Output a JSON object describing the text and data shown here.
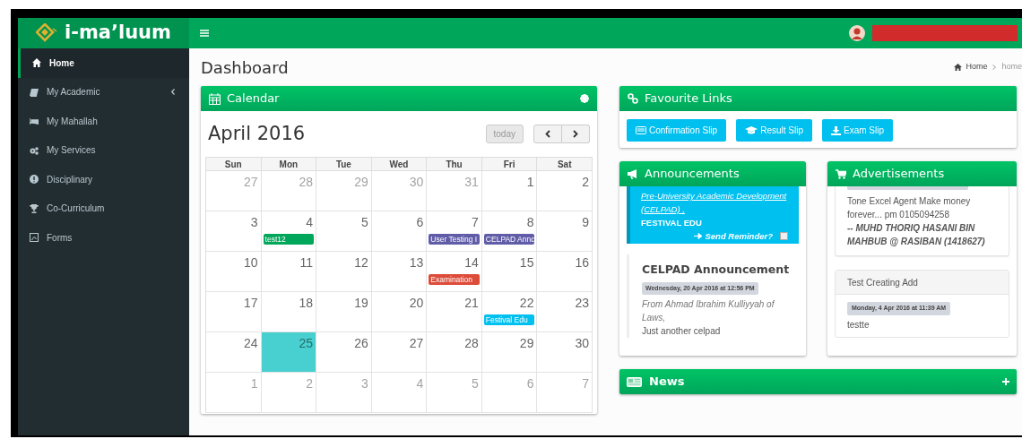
{
  "brand": {
    "logo_text": "i-maʼluum"
  },
  "sidebar": {
    "items": [
      {
        "label": "Home",
        "kind": "home",
        "selected": true,
        "expandable": false
      },
      {
        "label": "My Academic",
        "kind": "book",
        "selected": false,
        "expandable": true
      },
      {
        "label": "My Mahallah",
        "kind": "bed",
        "selected": false,
        "expandable": false
      },
      {
        "label": "My Services",
        "kind": "gears",
        "selected": false,
        "expandable": false
      },
      {
        "label": "Disciplinary",
        "kind": "alert",
        "selected": false,
        "expandable": false
      },
      {
        "label": "Co-Curriculum",
        "kind": "trophy",
        "selected": false,
        "expandable": false
      },
      {
        "label": "Forms",
        "kind": "file",
        "selected": false,
        "expandable": false
      }
    ]
  },
  "page_title": "Dashboard",
  "breadcrumb": [
    "Home",
    "home"
  ],
  "calendar": {
    "title": "Calendar",
    "month": "April 2016",
    "today_button": "today",
    "today_button_disabled": true,
    "weekdays": [
      "Sun",
      "Mon",
      "Tue",
      "Wed",
      "Thu",
      "Fri",
      "Sat"
    ],
    "weeks": [
      [
        {
          "day": "27",
          "other_month": true
        },
        {
          "day": "28",
          "other_month": true
        },
        {
          "day": "29",
          "other_month": true
        },
        {
          "day": "30",
          "other_month": true
        },
        {
          "day": "31",
          "other_month": true
        },
        {
          "day": "1",
          "other_month": false
        },
        {
          "day": "2",
          "other_month": false
        }
      ],
      [
        {
          "day": "3",
          "other_month": false
        },
        {
          "day": "4",
          "other_month": false,
          "events": [
            {
              "label": "test12",
              "color": "#00a65a"
            }
          ]
        },
        {
          "day": "5",
          "other_month": false
        },
        {
          "day": "6",
          "other_month": false
        },
        {
          "day": "7",
          "other_month": false,
          "events": [
            {
              "label": "User Testing I",
              "color": "#605ca8"
            }
          ]
        },
        {
          "day": "8",
          "other_month": false,
          "events": [
            {
              "label": "CELPAD Annc",
              "color": "#605ca8"
            }
          ]
        },
        {
          "day": "9",
          "other_month": false
        }
      ],
      [
        {
          "day": "10",
          "other_month": false
        },
        {
          "day": "11",
          "other_month": false
        },
        {
          "day": "12",
          "other_month": false
        },
        {
          "day": "13",
          "other_month": false
        },
        {
          "day": "14",
          "other_month": false,
          "events": [
            {
              "label": "Examination",
              "color": "#dd4b39"
            }
          ]
        },
        {
          "day": "15",
          "other_month": false
        },
        {
          "day": "16",
          "other_month": false
        }
      ],
      [
        {
          "day": "17",
          "other_month": false
        },
        {
          "day": "18",
          "other_month": false
        },
        {
          "day": "19",
          "other_month": false
        },
        {
          "day": "20",
          "other_month": false
        },
        {
          "day": "21",
          "other_month": false
        },
        {
          "day": "22",
          "other_month": false,
          "events": [
            {
              "label": "Festival Edu",
              "color": "#00c0ef"
            }
          ]
        },
        {
          "day": "23",
          "other_month": false
        }
      ],
      [
        {
          "day": "24",
          "other_month": false
        },
        {
          "day": "25",
          "other_month": false,
          "today": true
        },
        {
          "day": "26",
          "other_month": false
        },
        {
          "day": "27",
          "other_month": false
        },
        {
          "day": "28",
          "other_month": false
        },
        {
          "day": "29",
          "other_month": false
        },
        {
          "day": "30",
          "other_month": false
        }
      ],
      [
        {
          "day": "1",
          "other_month": true
        },
        {
          "day": "2",
          "other_month": true
        },
        {
          "day": "3",
          "other_month": true
        },
        {
          "day": "4",
          "other_month": true
        },
        {
          "day": "5",
          "other_month": true
        },
        {
          "day": "6",
          "other_month": true
        },
        {
          "day": "7",
          "other_month": true
        }
      ]
    ]
  },
  "favourite_links": {
    "title": "Favourite Links",
    "links": [
      {
        "label": "Confirmation Slip",
        "kind": "card"
      },
      {
        "label": "Result Slip",
        "kind": "cap"
      },
      {
        "label": "Exam Slip",
        "kind": "download"
      }
    ]
  },
  "announcements": {
    "title": "Announcements",
    "callout": {
      "link": "Pre-University Academic Development (CELPAD) ,",
      "text": "FESTIVAL EDU",
      "reminder": "Send Reminder?",
      "reminder_checked": false
    },
    "post": {
      "heading": "CELPAD Announcement",
      "date": "Wednesday, 20 Apr 2016 at 12:56 PM",
      "from": "From Ahmad Ibrahim Kulliyyah of Laws,",
      "body": "Just another celpad"
    }
  },
  "advertisements": {
    "title": "Advertisements",
    "items": [
      {
        "kind": "plain",
        "text": "Tone Excel Agent Make money forever... pm 0105094258",
        "author": "-- MUHD THORIQ HASANI BIN MAHBUB @ RASIBAN (1418627)"
      },
      {
        "kind": "titled",
        "title": "Test Creating Add",
        "date": "Monday, 4 Apr 2016 at 11:39 AM",
        "text": "testte"
      }
    ]
  },
  "news": {
    "title": "News"
  }
}
